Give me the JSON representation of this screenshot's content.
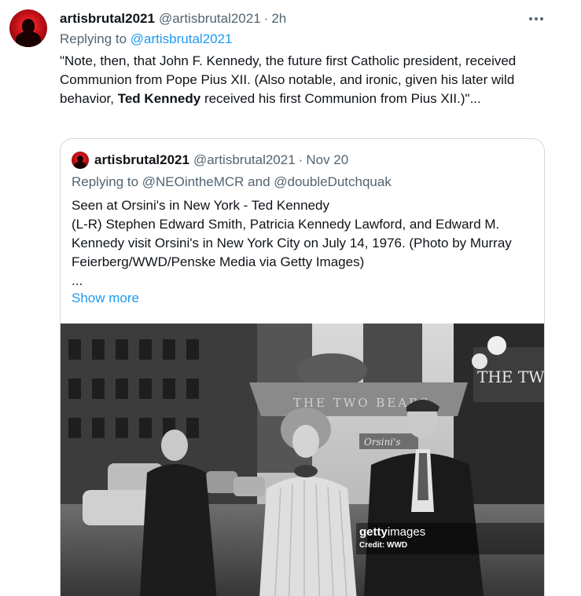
{
  "tweet": {
    "display_name": "artisbrutal2021",
    "handle": "@artisbrutal2021",
    "separator": "·",
    "time": "2h",
    "replying_prefix": "Replying to",
    "replying_to": "@artisbrutal2021",
    "text_part1": "\"Note, then, that John F. Kennedy, the future first Catholic president, received Communion from Pope Pius XII. (Also notable, and ironic, given his later wild behavior, ",
    "text_bold": "Ted Kennedy",
    "text_part2": " received his first Communion from Pius XII.)\"...",
    "more_icon": "more-horizontal-icon"
  },
  "quoted": {
    "display_name": "artisbrutal2021",
    "handle": "@artisbrutal2021",
    "separator": "·",
    "time": "Nov 20",
    "replying_line": "Replying to @NEOintheMCR and @doubleDutchquak",
    "text": "Seen at Orsini's in New York - Ted Kennedy\n(L-R)  Stephen Edward Smith, Patricia Kennedy Lawford, and Edward M. Kennedy  visit Orsini's in New York City on July 14, 1976. (Photo by Murray  Feierberg/WWD/Penske Media via Getty Images)\n...",
    "show_more": "Show more",
    "photo": {
      "awning_text": "THE TWO BEARS",
      "sign_text": "Orsini's",
      "side_sign_text": "THE TWO BE",
      "watermark_brand_bold": "getty",
      "watermark_brand_rest": "images",
      "watermark_credit": "Credit: WWD"
    }
  }
}
